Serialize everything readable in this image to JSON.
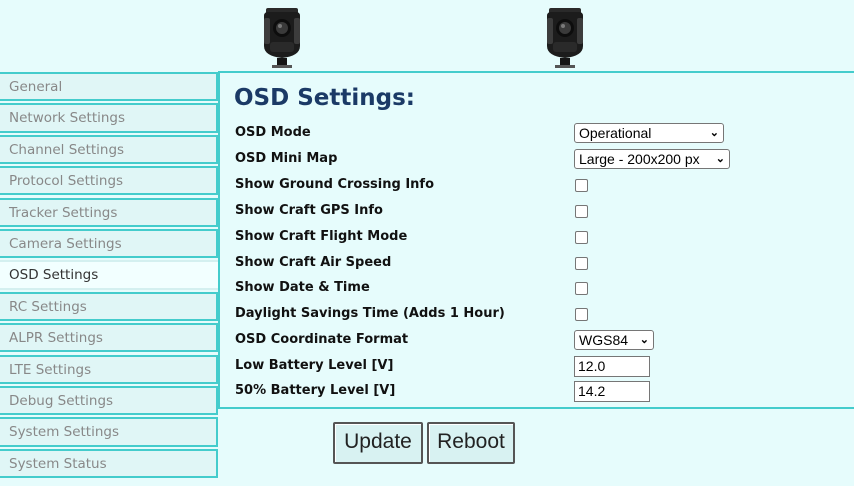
{
  "header": {
    "logo_icons": [
      "camera-gimbal-icon",
      "camera-gimbal-icon"
    ]
  },
  "sidebar": {
    "items": [
      {
        "label": "General"
      },
      {
        "label": "Network Settings"
      },
      {
        "label": "Channel Settings"
      },
      {
        "label": "Protocol Settings"
      },
      {
        "label": "Tracker Settings"
      },
      {
        "label": "Camera Settings"
      },
      {
        "label": "OSD Settings"
      },
      {
        "label": "RC Settings"
      },
      {
        "label": "ALPR Settings"
      },
      {
        "label": "LTE Settings"
      },
      {
        "label": "Debug Settings"
      },
      {
        "label": "System Settings"
      },
      {
        "label": "System Status"
      }
    ],
    "active_item": "OSD Settings"
  },
  "main": {
    "title": "OSD Settings:",
    "fields": {
      "osd_mode": {
        "label": "OSD Mode",
        "type": "select",
        "value": "Operational"
      },
      "osd_mini_map": {
        "label": "OSD Mini Map",
        "type": "select",
        "value": "Large - 200x200 px"
      },
      "show_ground_crossing": {
        "label": "Show Ground Crossing Info",
        "type": "checkbox",
        "checked": false
      },
      "show_craft_gps": {
        "label": "Show Craft GPS Info",
        "type": "checkbox",
        "checked": false
      },
      "show_craft_flight_mode": {
        "label": "Show Craft Flight Mode",
        "type": "checkbox",
        "checked": false
      },
      "show_craft_air_speed": {
        "label": "Show Craft Air Speed",
        "type": "checkbox",
        "checked": false
      },
      "show_date_time": {
        "label": "Show Date & Time",
        "type": "checkbox",
        "checked": false
      },
      "daylight_savings": {
        "label": "Daylight Savings Time (Adds 1 Hour)",
        "type": "checkbox",
        "checked": false
      },
      "osd_coordinate_format": {
        "label": "OSD Coordinate Format",
        "type": "select",
        "value": "WGS84"
      },
      "low_battery_level": {
        "label": "Low Battery Level [V]",
        "type": "text",
        "value": "12.0"
      },
      "half_battery_level": {
        "label": "50% Battery Level [V]",
        "type": "text",
        "value": "14.2"
      }
    }
  },
  "buttons": {
    "update_label": "Update",
    "reboot_label": "Reboot"
  },
  "colors": {
    "background": "#e6fcfc",
    "border_accent": "#44cccc",
    "title": "#1b3a66"
  }
}
